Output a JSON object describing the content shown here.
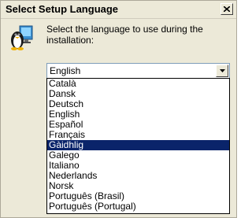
{
  "window": {
    "title": "Select Setup Language",
    "close_icon": "close-icon"
  },
  "dialog": {
    "icon": "setup-icon",
    "prompt": "Select the language to use during the installation:"
  },
  "language_select": {
    "value": "English",
    "options": [
      "Català",
      "Dansk",
      "Deutsch",
      "English",
      "Español",
      "Français",
      "Gàidhlig",
      "Galego",
      "Italiano",
      "Nederlands",
      "Norsk",
      "Português (Brasil)",
      "Português (Portugal)"
    ],
    "highlighted": "Gàidhlig"
  },
  "colors": {
    "selection": "#0a246a",
    "window_bg": "#ece9d8"
  }
}
